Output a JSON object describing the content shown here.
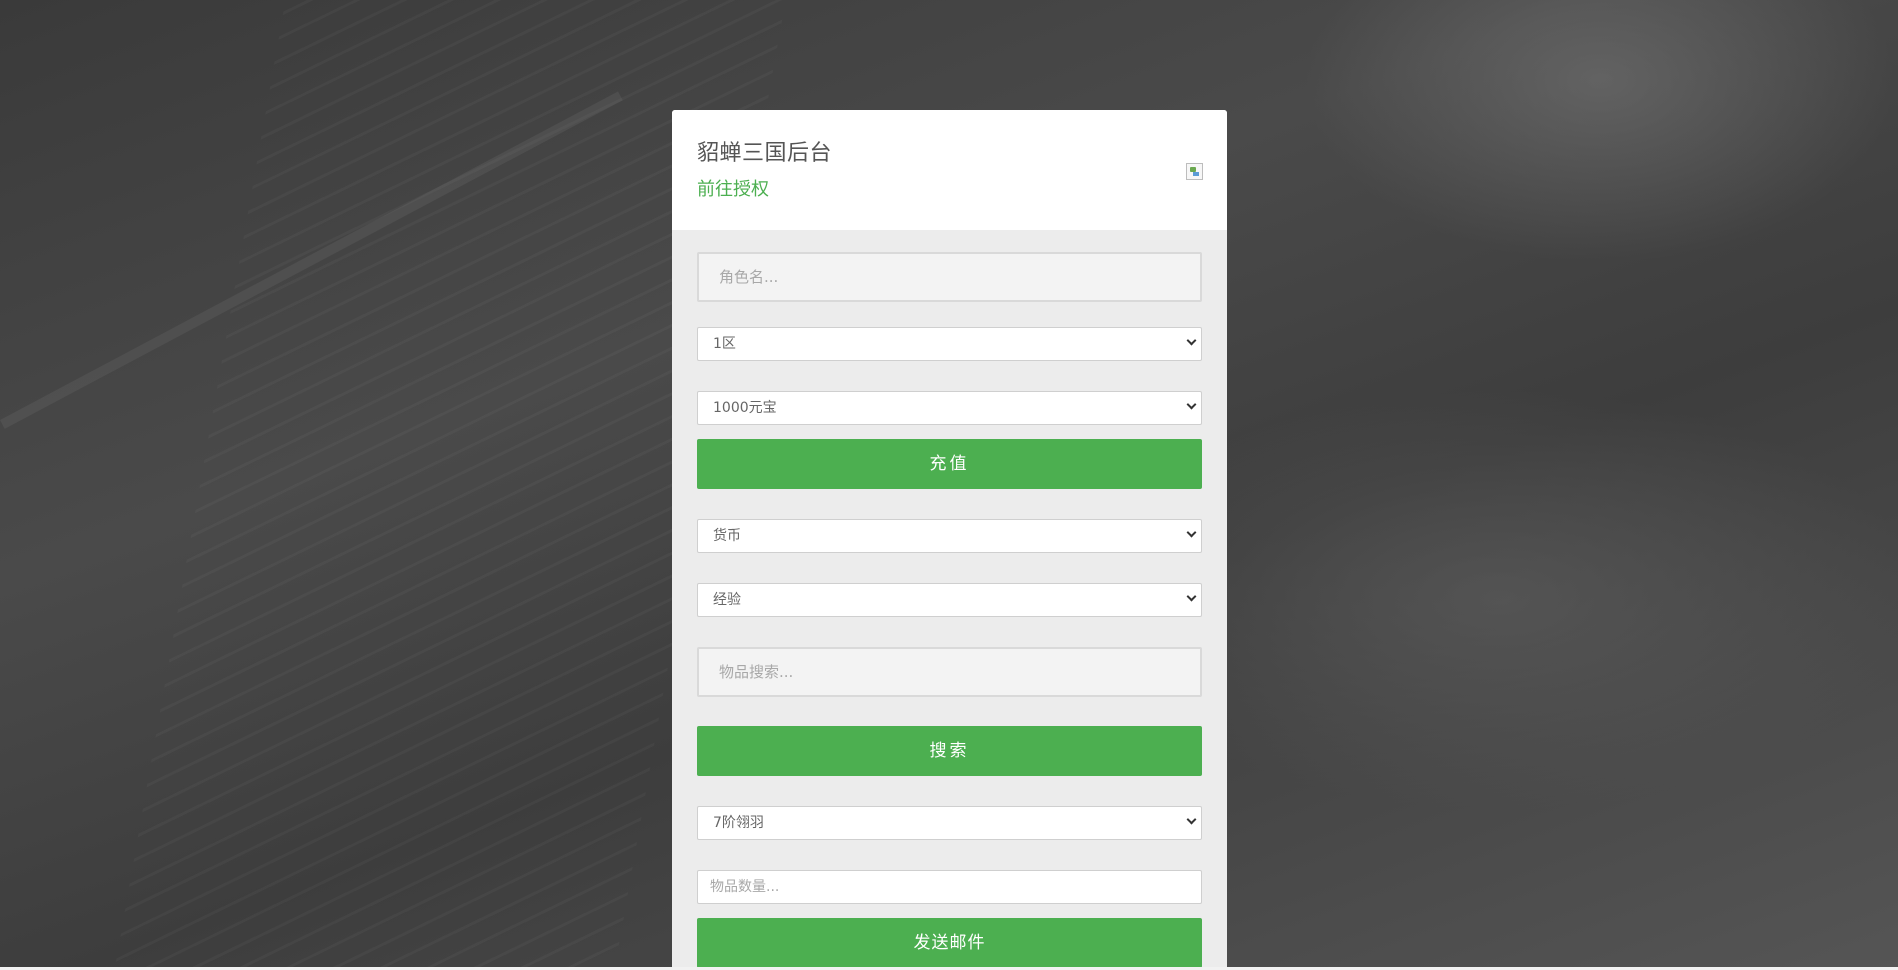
{
  "card": {
    "title": "貂蝉三国后台",
    "link": "前往授权",
    "header_image": "broken-image-icon"
  },
  "form": {
    "role_placeholder": "角色名...",
    "zone_select": "1区",
    "recharge_select": "1000元宝",
    "recharge_button": "充值",
    "currency_select": "货币",
    "exp_select": "经验",
    "item_search_placeholder": "物品搜索...",
    "search_button": "搜索",
    "item_select": "7阶翎羽",
    "item_qty_placeholder": "物品数量...",
    "mail_button": "发送邮件"
  },
  "colors": {
    "accent": "#4caf50",
    "card_bg": "#ececec",
    "header_bg": "#ffffff"
  }
}
